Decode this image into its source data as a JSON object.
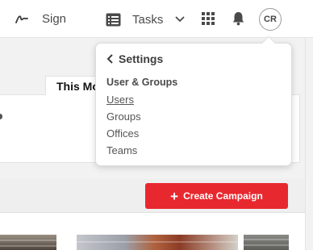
{
  "header": {
    "sign_label": "Sign",
    "tasks_label": "Tasks",
    "avatar_initials": "CR",
    "icons": [
      "signature-icon",
      "tasks-icon",
      "chevron-down-icon",
      "apps-grid-icon",
      "bell-icon"
    ]
  },
  "page": {
    "tab_label": "This Mo",
    "create_button_label": "Create Campaign"
  },
  "settings_menu": {
    "back_label": "Settings",
    "section_title": "User & Groups",
    "items": [
      {
        "label": "Users",
        "active": true
      },
      {
        "label": "Groups",
        "active": false
      },
      {
        "label": "Offices",
        "active": false
      },
      {
        "label": "Teams",
        "active": false
      }
    ]
  },
  "colors": {
    "accent_red": "#e8282f",
    "text_dark": "#4a4a4a",
    "background_gray": "#f2f2f2"
  }
}
